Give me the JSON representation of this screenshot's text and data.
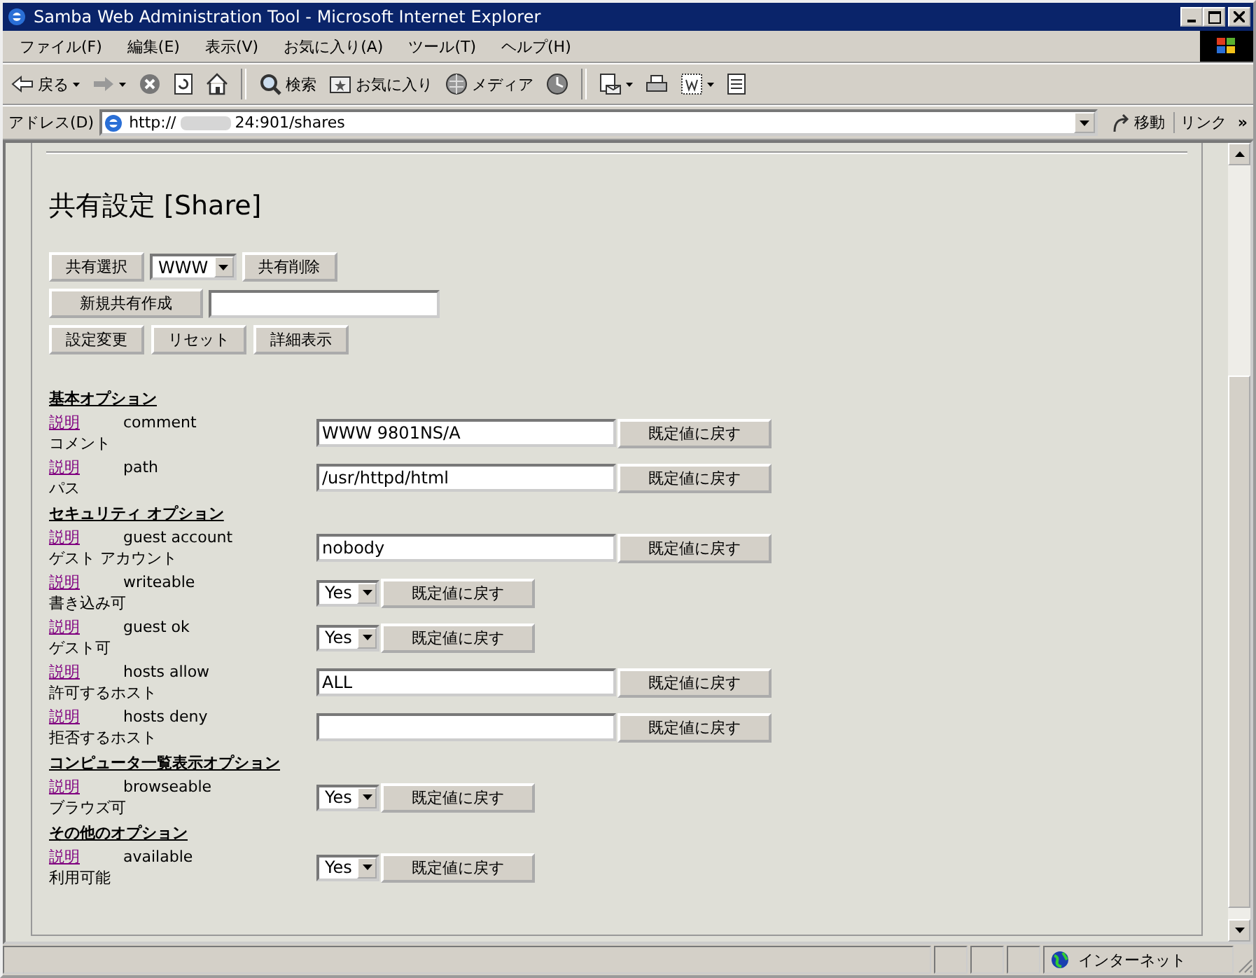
{
  "window": {
    "title": "Samba Web Administration Tool - Microsoft Internet Explorer"
  },
  "menu": [
    "ファイル(F)",
    "編集(E)",
    "表示(V)",
    "お気に入り(A)",
    "ツール(T)",
    "ヘルプ(H)"
  ],
  "toolbar": [
    {
      "kind": "back",
      "label": "戻る",
      "dropdown": true
    },
    {
      "kind": "forward",
      "dropdown": true
    },
    {
      "kind": "stop",
      "dropdown": false
    },
    {
      "kind": "refresh",
      "dropdown": false
    },
    {
      "kind": "home",
      "dropdown": false
    },
    {
      "kind": "separator"
    },
    {
      "kind": "search",
      "label": "検索",
      "dropdown": false
    },
    {
      "kind": "favorites",
      "label": "お気に入り",
      "dropdown": false
    },
    {
      "kind": "media",
      "label": "メディア",
      "dropdown": false
    },
    {
      "kind": "history",
      "dropdown": false
    },
    {
      "kind": "separator"
    },
    {
      "kind": "mail",
      "dropdown": true
    },
    {
      "kind": "print",
      "dropdown": false
    },
    {
      "kind": "edit",
      "dropdown": true
    },
    {
      "kind": "discuss",
      "dropdown": false
    }
  ],
  "address": {
    "label": "アドレス(D)",
    "prefix": "http://",
    "suffix": "24:901/shares",
    "go": "移動",
    "links": "リンク",
    "more": "»"
  },
  "page": {
    "heading": "共有設定 [Share]",
    "share_select_button": "共有選択",
    "share_value": "WWW",
    "delete_button": "共有削除",
    "create_button": "新規共有作成",
    "action_buttons": [
      "設定変更",
      "リセット",
      "詳細表示"
    ],
    "sections": [
      {
        "title": "基本オプション",
        "options": [
          {
            "help": "説明",
            "name": "comment",
            "label": "コメント",
            "kind": "text",
            "value": "WWW 9801NS/A",
            "reset": "既定値に戻す"
          },
          {
            "help": "説明",
            "name": "path",
            "label": "パス",
            "kind": "text",
            "value": "/usr/httpd/html",
            "reset": "既定値に戻す"
          }
        ]
      },
      {
        "title": "セキュリティ オプション",
        "options": [
          {
            "help": "説明",
            "name": "guest account",
            "label": "ゲスト アカウント",
            "kind": "text",
            "value": "nobody",
            "reset": "既定値に戻す"
          },
          {
            "help": "説明",
            "name": "writeable",
            "label": "書き込み可",
            "kind": "select",
            "value": "Yes",
            "reset": "既定値に戻す"
          },
          {
            "help": "説明",
            "name": "guest ok",
            "label": "ゲスト可",
            "kind": "select",
            "value": "Yes",
            "reset": "既定値に戻す"
          },
          {
            "help": "説明",
            "name": "hosts allow",
            "label": "許可するホスト",
            "kind": "text",
            "value": "ALL",
            "reset": "既定値に戻す"
          },
          {
            "help": "説明",
            "name": "hosts deny",
            "label": "拒否するホスト",
            "kind": "text",
            "reset": "既定値に戻す"
          }
        ]
      },
      {
        "title": "コンピュータ一覧表示オプション",
        "options": [
          {
            "help": "説明",
            "name": "browseable",
            "label": "ブラウズ可",
            "kind": "select",
            "value": "Yes",
            "reset": "既定値に戻す"
          }
        ]
      },
      {
        "title": "その他のオプション",
        "options": [
          {
            "help": "説明",
            "name": "available",
            "label": "利用可能",
            "kind": "select",
            "value": "Yes",
            "reset": "既定値に戻す"
          }
        ]
      }
    ]
  },
  "status_bar": {
    "zone": "インターネット"
  }
}
